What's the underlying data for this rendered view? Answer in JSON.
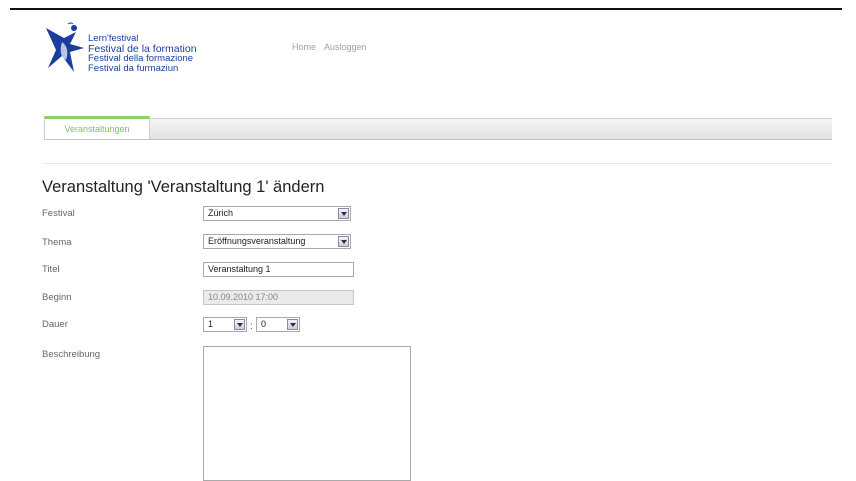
{
  "logo": {
    "lines": [
      "Lern'festival",
      "Festival de la formation",
      "Festival della formazione",
      "Festival da furmaziun"
    ]
  },
  "topnav": {
    "home": "Home",
    "logout": "Ausloggen"
  },
  "tabs": [
    {
      "label": "Veranstaltungen",
      "active": true
    }
  ],
  "page": {
    "title": "Veranstaltung 'Veranstaltung 1' ändern"
  },
  "form": {
    "festival": {
      "label": "Festival",
      "value": "Zürich"
    },
    "thema": {
      "label": "Thema",
      "value": "Eröffnungsveranstaltung"
    },
    "titel": {
      "label": "Titel",
      "value": "Veranstaltung 1"
    },
    "beginn": {
      "label": "Beginn",
      "value": "10.09.2010 17:00"
    },
    "dauer": {
      "label": "Dauer",
      "hours": "1",
      "separator": ":",
      "minutes": "0"
    },
    "beschreibung": {
      "label": "Beschreibung",
      "value": ""
    }
  },
  "colors": {
    "logo_blue": "#1a3ea0",
    "tab_accent": "#8fcf6a"
  }
}
